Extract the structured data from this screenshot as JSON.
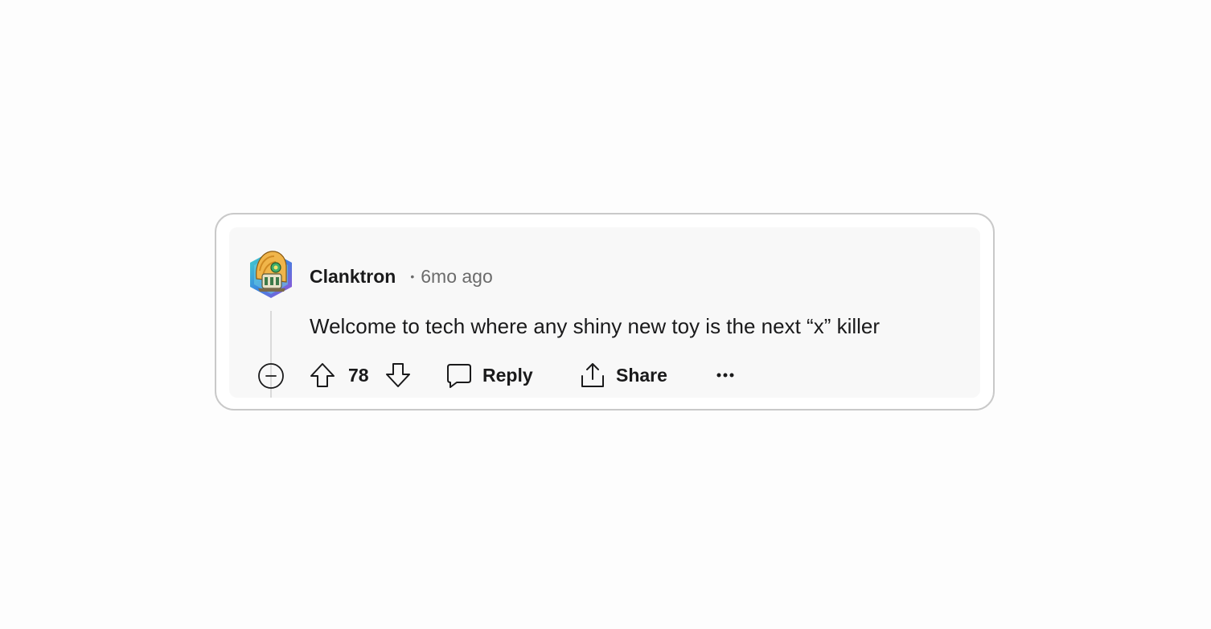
{
  "comment": {
    "author": "Clanktron",
    "separator": "•",
    "time": "6mo ago",
    "body": "Welcome to tech where any shiny new toy is the next “x” killer",
    "score": "78"
  },
  "actions": {
    "reply_label": "Reply",
    "share_label": "Share",
    "more_label": "•••"
  },
  "icons": {
    "avatar": "snoo-avatar-icon",
    "collapse": "collapse-minus-icon",
    "upvote": "upvote-arrow-icon",
    "downvote": "downvote-arrow-icon",
    "reply": "speech-bubble-icon",
    "share": "share-upload-icon",
    "more": "more-dots-icon"
  },
  "colors": {
    "text": "#1a1a1b",
    "muted": "#6b6b6b",
    "card_border": "#c9c9c9",
    "card_inner": "#f8f8f8"
  }
}
